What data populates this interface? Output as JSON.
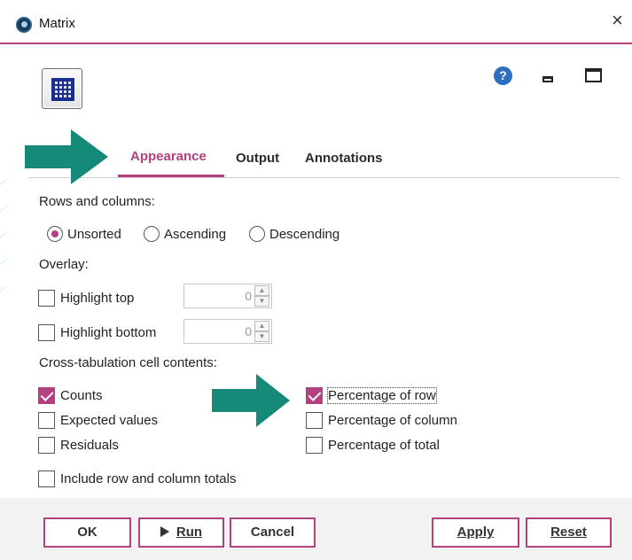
{
  "window": {
    "title": "Matrix",
    "close_glyph": "×",
    "help_glyph": "?"
  },
  "tabs": {
    "partial_left": "s",
    "items": [
      {
        "label": "Appearance",
        "active": true
      },
      {
        "label": "Output",
        "active": false
      },
      {
        "label": "Annotations",
        "active": false
      }
    ]
  },
  "rows_columns": {
    "label": "Rows and columns:",
    "options": [
      {
        "label": "Unsorted",
        "selected": true
      },
      {
        "label": "Ascending",
        "selected": false
      },
      {
        "label": "Descending",
        "selected": false
      }
    ]
  },
  "overlay": {
    "label": "Overlay:",
    "highlight_top": {
      "label": "Highlight top",
      "checked": false,
      "value": "0"
    },
    "highlight_bottom": {
      "label": "Highlight bottom",
      "checked": false,
      "value": "0"
    }
  },
  "cell_contents": {
    "label": "Cross-tabulation cell contents:",
    "counts": {
      "label": "Counts",
      "checked": true
    },
    "expected_values": {
      "label": "Expected values",
      "checked": false
    },
    "residuals": {
      "label": "Residuals",
      "checked": false
    },
    "percentage_of_row": {
      "label": "Percentage of row",
      "checked": true
    },
    "percentage_of_column": {
      "label": "Percentage of column",
      "checked": false
    },
    "percentage_of_total": {
      "label": "Percentage of total",
      "checked": false
    },
    "include_totals": {
      "label": "Include row and column totals",
      "checked": false
    }
  },
  "buttons": {
    "ok": "OK",
    "run": "Run",
    "cancel": "Cancel",
    "apply": "Apply",
    "reset": "Reset"
  },
  "colors": {
    "accent": "#b5407f",
    "arrow": "#158a78"
  }
}
